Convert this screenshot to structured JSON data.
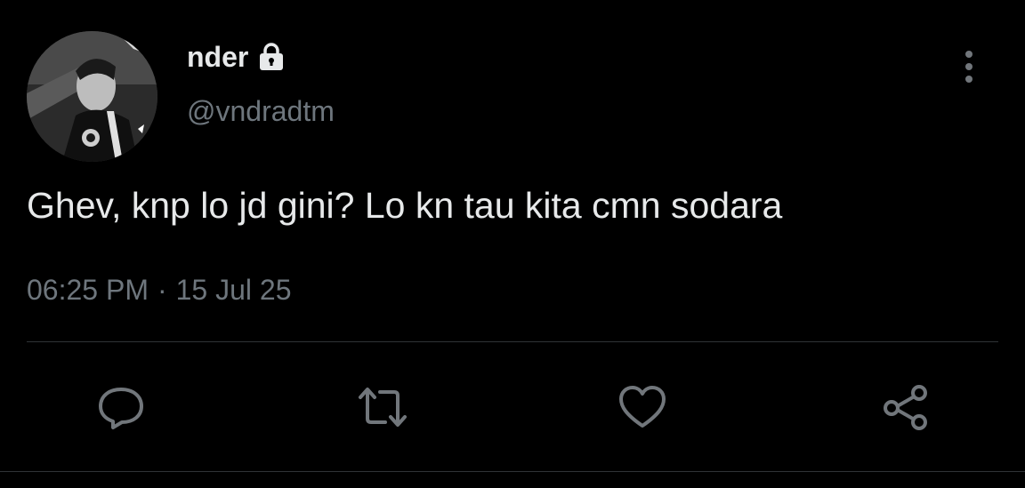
{
  "user": {
    "display_name": "nder",
    "handle": "@vndradtm",
    "protected_icon": "lock-icon",
    "avatar": "profile-photo-monochrome"
  },
  "tweet": {
    "text": "Ghev, knp lo jd gini? Lo kn tau kita cmn sodara",
    "time": "06:25 PM",
    "separator": "·",
    "date": "15 Jul 25"
  },
  "actions": {
    "more_icon": "more-vertical-icon",
    "reply_icon": "reply-icon",
    "retweet_icon": "retweet-icon",
    "like_icon": "heart-icon",
    "share_icon": "share-icon"
  },
  "colors": {
    "background": "#000000",
    "text_primary": "#e7e9ea",
    "text_secondary": "#6e767d",
    "divider": "#2f3336",
    "icon": "#71767b"
  }
}
